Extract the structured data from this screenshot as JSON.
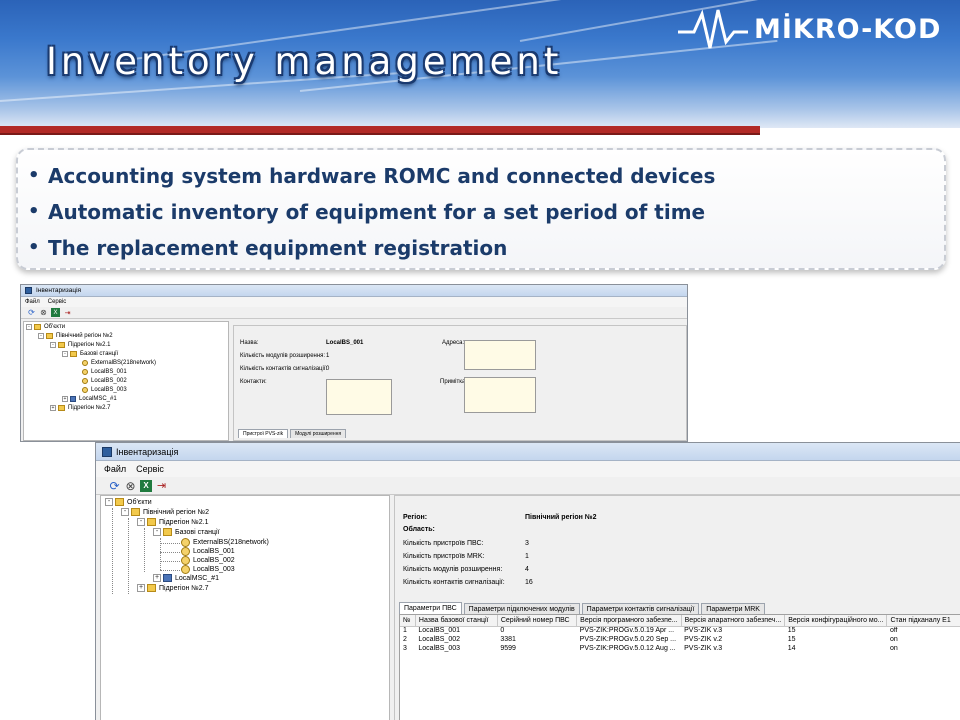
{
  "slide": {
    "title": "Inventory management",
    "logo_text": "MİKRO-KOD",
    "bullets": [
      "Accounting system hardware ROMC and connected devices",
      "Automatic inventory of equipment for a set period of time",
      "The replacement equipment registration"
    ],
    "colors": {
      "header_blue": "#2b63b8",
      "rule_red": "#b22a26",
      "bullet_text": "#1b3b6a"
    }
  },
  "window_back": {
    "title": "Інвентаризація",
    "menu": [
      "Файл",
      "Сервіс"
    ],
    "toolbar_icons": [
      "refresh-icon",
      "stop-icon",
      "excel-icon",
      "exit-icon"
    ],
    "tree": {
      "root": "Об'єкти",
      "region": "Північний регіон №2",
      "subregion1": "Підрегіон №2.1",
      "bs_group": "Базові станції",
      "bs_ext": "ExternalBS(218network)",
      "bs1": "LocalBS_001",
      "bs2": "LocalBS_002",
      "bs3": "LocalBS_003",
      "msc": "LocalMSC_#1",
      "subregion2": "Підрегіон №2.7"
    },
    "fields": {
      "name_label": "Назва:",
      "name_value": "LocalBS_001",
      "address_label": "Адреса:",
      "modules_label": "Кількість модулів розширення:",
      "modules_value": "1",
      "contacts_count_label": "Кількість контактів сигналізації:",
      "contacts_count_value": "0",
      "contacts_label": "Контакти:",
      "note_label": "Примітка:"
    },
    "tabs": [
      "Пристрої PVS-zik",
      "Модулі розширення"
    ]
  },
  "window_front": {
    "title": "Інвентаризація",
    "menu": [
      "Файл",
      "Сервіс"
    ],
    "toolbar_icons": [
      "refresh-icon",
      "stop-icon",
      "excel-icon",
      "exit-icon"
    ],
    "tree": {
      "root": "Об'єкти",
      "region": "Північний регіон №2",
      "subregion1": "Підрегіон №2.1",
      "bs_group": "Базові станції",
      "bs_ext": "ExternalBS(218network)",
      "bs1": "LocalBS_001",
      "bs2": "LocalBS_002",
      "bs3": "LocalBS_003",
      "msc": "LocalMSC_#1",
      "subregion2": "Підрегіон №2.7"
    },
    "fields": {
      "region_label": "Регіон:",
      "region_value": "Північний регіон №2",
      "area_label": "Область:",
      "pvs_label": "Кількість пристроїв ПВС:",
      "pvs_value": "3",
      "mrk_label": "Кількість пристроїв MRK:",
      "mrk_value": "1",
      "modules_label": "Кількість модулів розширення:",
      "modules_value": "4",
      "contacts_label": "Кількість контактів сигналізації:",
      "contacts_value": "16"
    },
    "tabs": [
      "Параметри ПВС",
      "Параметри підключених модулів",
      "Параметри контактів сигналізації",
      "Параметри MRK"
    ],
    "table": {
      "headers": [
        "№",
        "Назва базової станції",
        "Серійний номер ПВС",
        "Версія програмного забезпе...",
        "Версія апаратного забезпеч...",
        "Версія конфігураційного мо...",
        "Стан підканалу Е1"
      ],
      "rows": [
        [
          "1",
          "LocalBS_001",
          "0",
          "PVS-ZIK:PROGv.5.0.19 Apr ...",
          "PVS-ZIK v.3",
          "15",
          "off"
        ],
        [
          "2",
          "LocalBS_002",
          "3381",
          "PVS-ZIK:PROGv.5.0.20 Sep ...",
          "PVS-ZIK v.2",
          "15",
          "on"
        ],
        [
          "3",
          "LocalBS_003",
          "9599",
          "PVS-ZIK:PROGv.5.0.12 Aug ...",
          "PVS-ZIK v.3",
          "14",
          "on"
        ]
      ]
    }
  }
}
